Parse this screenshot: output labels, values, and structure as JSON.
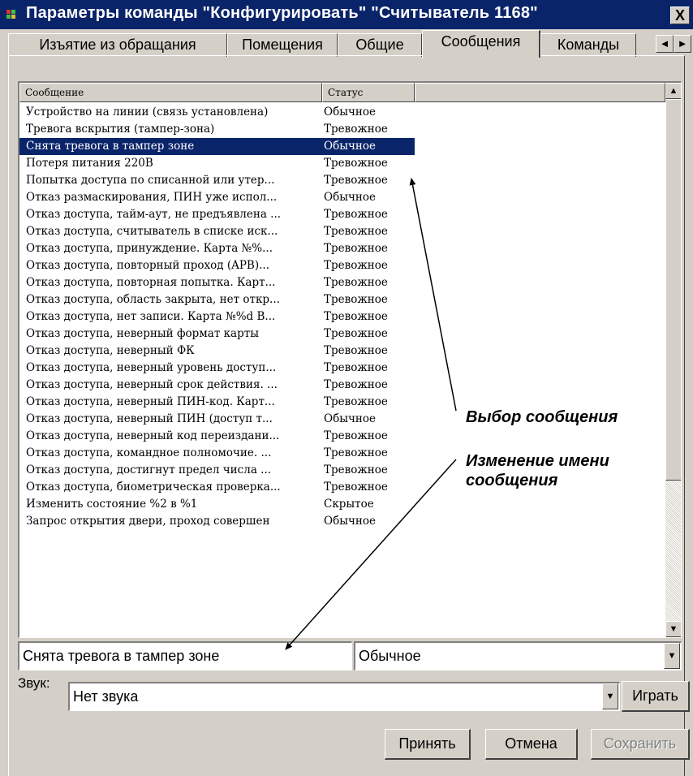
{
  "window": {
    "title": "Параметры команды \"Конфигурировать\" \"Считыватель 1168\"",
    "close_label": "X"
  },
  "tabs": [
    "Изъятие из обращания",
    "Помещения",
    "Общие",
    "Сообщения",
    "Команды"
  ],
  "active_tab": "Сообщения",
  "tab_scroll": {
    "left": "◄",
    "right": "►"
  },
  "list": {
    "columns": [
      "Сообщение",
      "Статус",
      ""
    ],
    "selected_index": 2,
    "rows": [
      [
        "Устройство на линии (связь установлена)",
        "Обычное"
      ],
      [
        "Тревога вскрытия (тампер-зона)",
        "Тревожное"
      ],
      [
        "Снята тревога в тампер зоне",
        "Обычное"
      ],
      [
        "Потеря питания 220В",
        "Тревожное"
      ],
      [
        "Попытка доступа по списанной или утер...",
        "Тревожное"
      ],
      [
        "Отказ размаскирования, ПИН уже испол...",
        "Обычное"
      ],
      [
        "Отказ доступа, тайм-аут, не предъявлена ...",
        "Тревожное"
      ],
      [
        "Отказ доступа, считыватель в списке иск...",
        "Тревожное"
      ],
      [
        "Отказ доступа, принуждение. Карта №%...",
        "Тревожное"
      ],
      [
        "Отказ доступа, повторный проход (APB)...",
        "Тревожное"
      ],
      [
        "Отказ доступа, повторная попытка. Карт...",
        "Тревожное"
      ],
      [
        "Отказ доступа, область закрыта, нет откр...",
        "Тревожное"
      ],
      [
        "Отказ доступа, нет записи. Карта №%d В...",
        "Тревожное"
      ],
      [
        "Отказ доступа, неверный формат карты",
        "Тревожное"
      ],
      [
        "Отказ доступа, неверный ФК",
        "Тревожное"
      ],
      [
        "Отказ доступа, неверный уровень доступ...",
        "Тревожное"
      ],
      [
        "Отказ доступа, неверный срок действия. ...",
        "Тревожное"
      ],
      [
        "Отказ доступа, неверный ПИН-код. Карт...",
        "Тревожное"
      ],
      [
        "Отказ доступа, неверный ПИН (доступ т...",
        "Обычное"
      ],
      [
        "Отказ доступа, неверный код переиздани...",
        "Тревожное"
      ],
      [
        "Отказ доступа, командное полномочие. ...",
        "Тревожное"
      ],
      [
        "Отказ доступа, достигнут предел числа ...",
        "Тревожное"
      ],
      [
        "Отказ доступа, биометрическая проверка...",
        "Тревожное"
      ],
      [
        "Изменить состояние %2 в %1",
        "Скрытое"
      ],
      [
        "Запрос открытия двери, проход совершен",
        "Обычное"
      ]
    ]
  },
  "message_name_field": {
    "value": "Снята тревога в тампер зоне"
  },
  "status_select": {
    "value": "Обычное"
  },
  "sound": {
    "label": "Звук:",
    "value": "Нет звука",
    "play_label": "Играть"
  },
  "buttons": {
    "accept": "Принять",
    "cancel": "Отмена",
    "save": "Сохранить"
  },
  "annotations": {
    "select_message": "Выбор сообщения",
    "rename_message_line1": "Изменение имени",
    "rename_message_line2": "сообщения"
  },
  "colors": {
    "title_bg": "#0a246a",
    "selection": "#0a246a",
    "window_bg": "#d4d0c8"
  }
}
